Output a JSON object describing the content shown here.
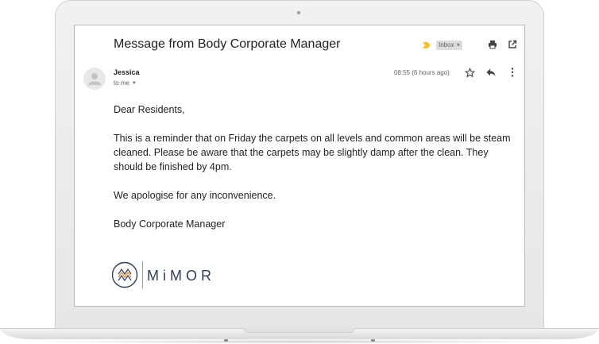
{
  "email": {
    "subject": "Message from Body Corporate Manager",
    "label": "Inbox",
    "label_close": "×",
    "sender": "Jessica",
    "recipient": "to me",
    "timestamp": "08:55 (6 hours ago)",
    "body": {
      "greeting": "Dear Residents,",
      "paragraph1": "This is a reminder that on Friday the carpets on all levels and common areas will be steam cleaned. Please be aware that the carpets may be slightly damp after the clean. They should be finished by 4pm.",
      "paragraph2": "We apologise for any inconvenience.",
      "signature": "Body Corporate Manager"
    },
    "logo_text": "MiMOR"
  },
  "icons": {
    "important": "important-marker-icon",
    "print": "print-icon",
    "popout": "open-in-new-window-icon",
    "star": "star-icon",
    "reply": "reply-icon",
    "more": "more-vertical-icon",
    "avatar": "default-avatar-icon"
  },
  "colors": {
    "important_marker": "#f6c026",
    "logo_blue": "#2e3f58",
    "logo_orange": "#e08a2c"
  }
}
